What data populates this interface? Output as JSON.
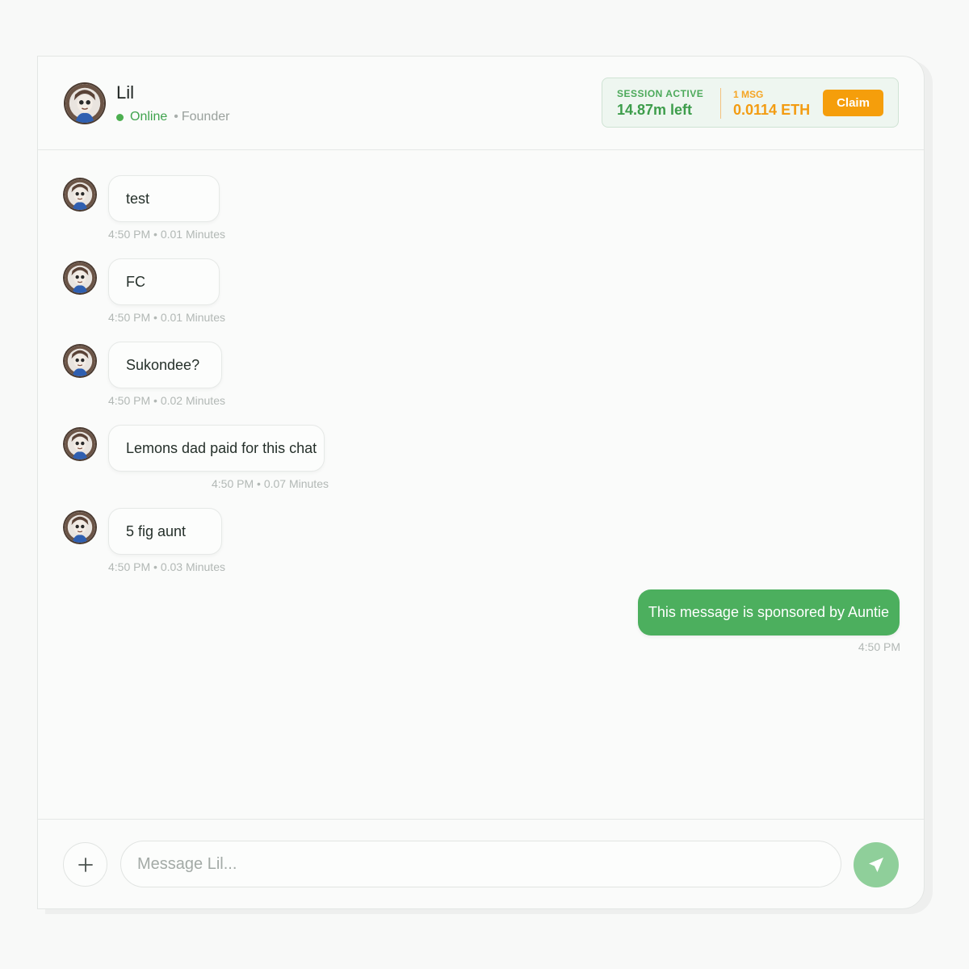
{
  "contact": {
    "name": "Lil",
    "status": "Online",
    "separator": "•",
    "role": "Founder"
  },
  "session": {
    "label": "SESSION ACTIVE",
    "time_left": "14.87m left",
    "msg_label": "1 MSG",
    "price": "0.0114 ETH",
    "claim_label": "Claim"
  },
  "messages": [
    {
      "text": "test",
      "meta": "4:50 PM • 0.01 Minutes"
    },
    {
      "text": "FC",
      "meta": "4:50 PM • 0.01 Minutes"
    },
    {
      "text": "Sukondee?",
      "meta": "4:50 PM • 0.02 Minutes"
    },
    {
      "text": "Lemons dad paid for this chat",
      "meta": "4:50 PM • 0.07 Minutes"
    },
    {
      "text": "5 fig aunt",
      "meta": "4:50 PM • 0.03 Minutes"
    }
  ],
  "outgoing": {
    "text": "This message is sponsored by Auntie",
    "time": "4:50 PM"
  },
  "composer": {
    "placeholder": "Message Lil...",
    "value": ""
  },
  "icons": {
    "attach": "plus-icon",
    "send": "send-icon",
    "avatar": "avatar-image"
  },
  "colors": {
    "accent_green": "#4caf5e",
    "online_green": "#3fa34d",
    "claim_orange": "#f59e0b",
    "price_orange": "#f39c12"
  }
}
